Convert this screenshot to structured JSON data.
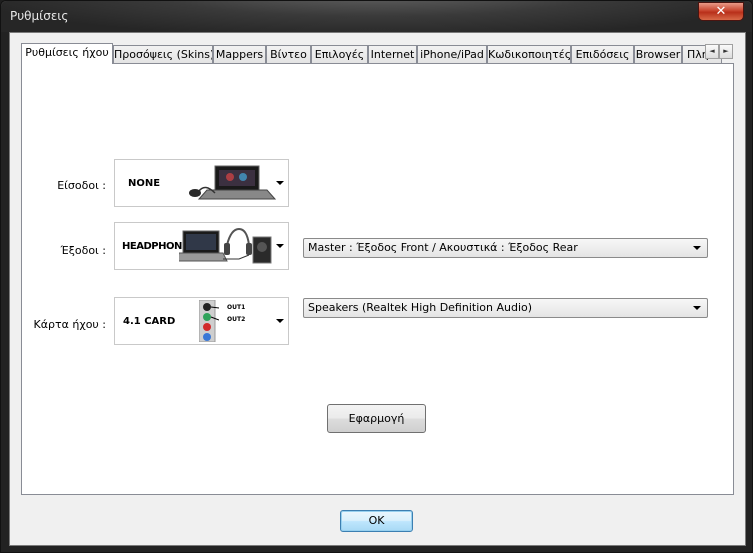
{
  "window": {
    "title": "Ρυθμίσεις",
    "close_label": "✕"
  },
  "tabs": [
    {
      "label": "Ρυθμίσεις ήχου",
      "active": true
    },
    {
      "label": "Προσόψεις (Skins)"
    },
    {
      "label": "Mappers"
    },
    {
      "label": "Βίντεο"
    },
    {
      "label": "Επιλογές"
    },
    {
      "label": "Internet"
    },
    {
      "label": "iPhone/iPad"
    },
    {
      "label": "Κωδικοποιητές"
    },
    {
      "label": "Επιδόσεις"
    },
    {
      "label": "Browser"
    },
    {
      "label": "Πλή"
    }
  ],
  "tab_scroll": {
    "left": "◄",
    "right": "►"
  },
  "audio": {
    "inputs_label": "Είσοδοι :",
    "inputs_value": "NONE",
    "outputs_label": "Έξοδοι :",
    "outputs_value": "HEADPHONES",
    "outputs_routing": "Master : Έξοδος Front / Ακουστικά : Έξοδος Rear",
    "card_label": "Κάρτα ήχου :",
    "card_value": "4.1 CARD",
    "card_out1": "OUT1",
    "card_out2": "OUT2",
    "card_device": "Speakers (Realtek High Definition Audio)",
    "apply_label": "Εφαρμογή"
  },
  "footer": {
    "ok_label": "OK"
  },
  "colors": {
    "jack_green": "#2fa35a",
    "jack_red": "#d22b2b",
    "jack_blue": "#3a78d6",
    "jack_black": "#222222"
  }
}
